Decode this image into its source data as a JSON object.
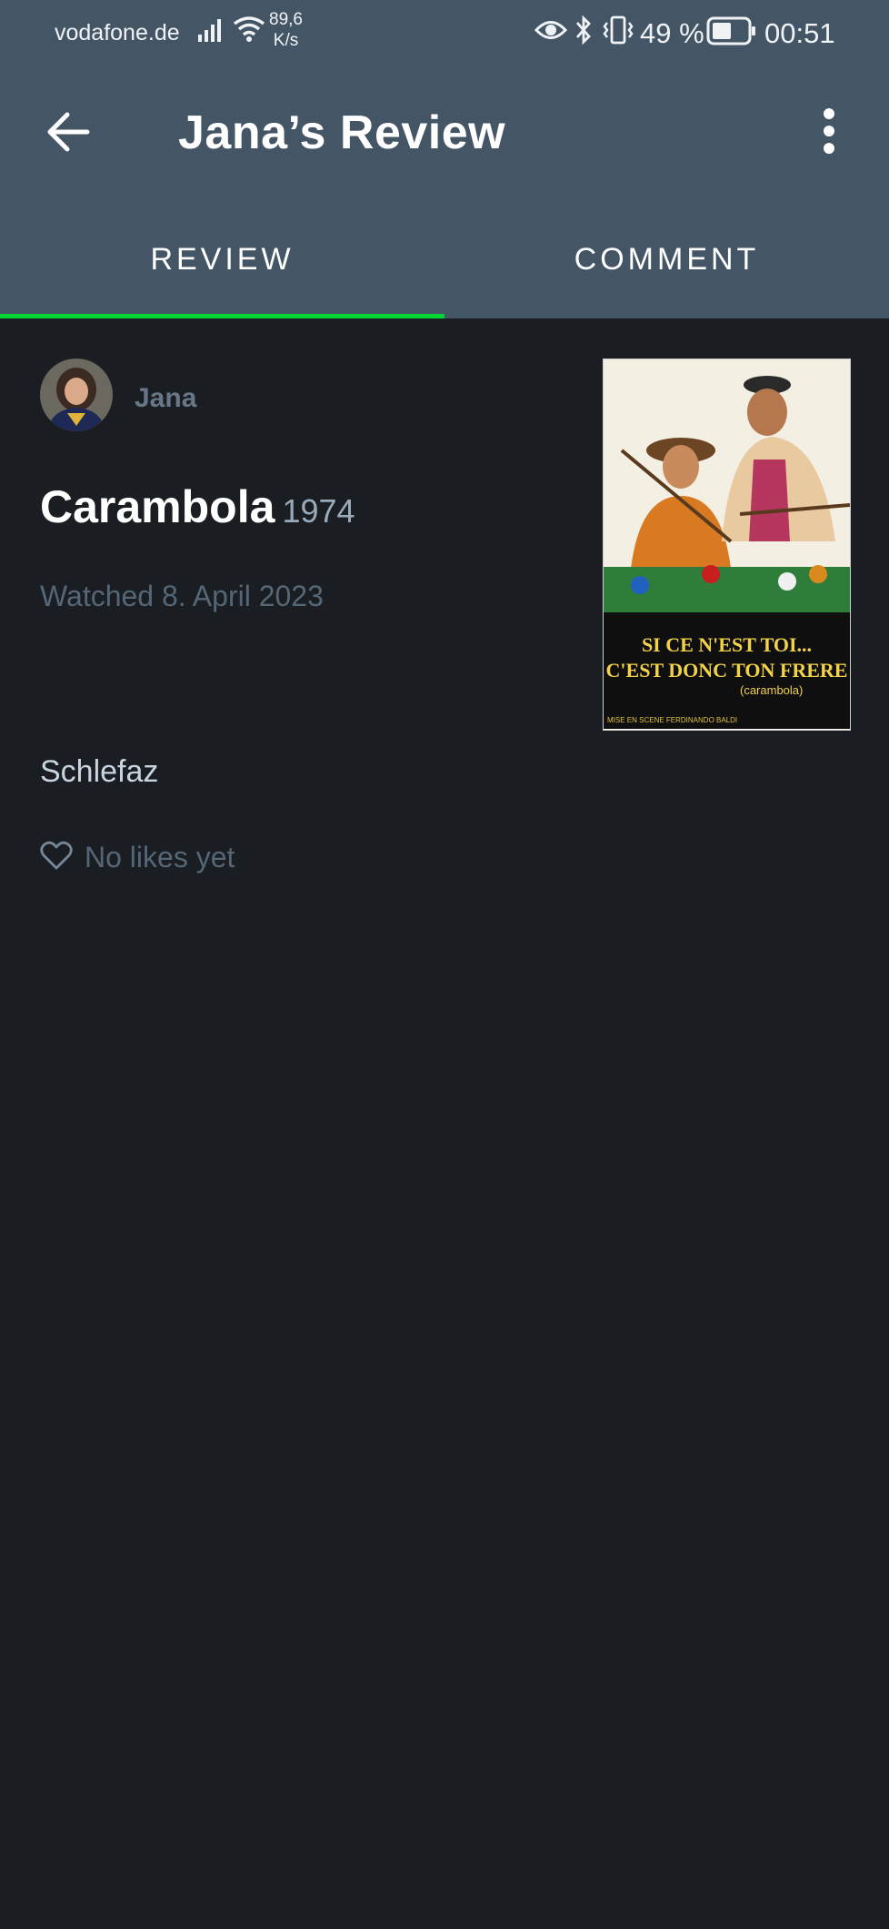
{
  "status_bar": {
    "carrier": "vodafone.de",
    "net_speed_value": "89,6",
    "net_speed_unit": "K/s",
    "battery_percent": "49 %",
    "time": "00:51",
    "icons": [
      "signal-icon",
      "wifi-icon",
      "eye-icon",
      "bluetooth-icon",
      "vibrate-icon",
      "battery-icon"
    ]
  },
  "app_bar": {
    "title": "Jana’s Review",
    "back_icon": "arrow-left-icon",
    "menu_icon": "more-vertical-icon"
  },
  "tabs": [
    {
      "label": "REVIEW",
      "active": true
    },
    {
      "label": "COMMENT",
      "active": false
    }
  ],
  "review": {
    "author": "Jana",
    "film_title": "Carambola",
    "film_year": "1974",
    "watched": "Watched 8. April 2023",
    "text": "Schlefaz",
    "likes": "No likes yet"
  },
  "poster": {
    "headline_line1": "SI CE N'EST TOI...",
    "headline_line2": "C'EST DONC TON FRERE",
    "subtitle": "(carambola)",
    "credit": "MISE EN SCENE FERDINANDO BALDI"
  },
  "colors": {
    "app_bar": "#445566",
    "background": "#1a1d21",
    "accent": "#00d735",
    "muted": "#556677",
    "username": "#677788"
  }
}
